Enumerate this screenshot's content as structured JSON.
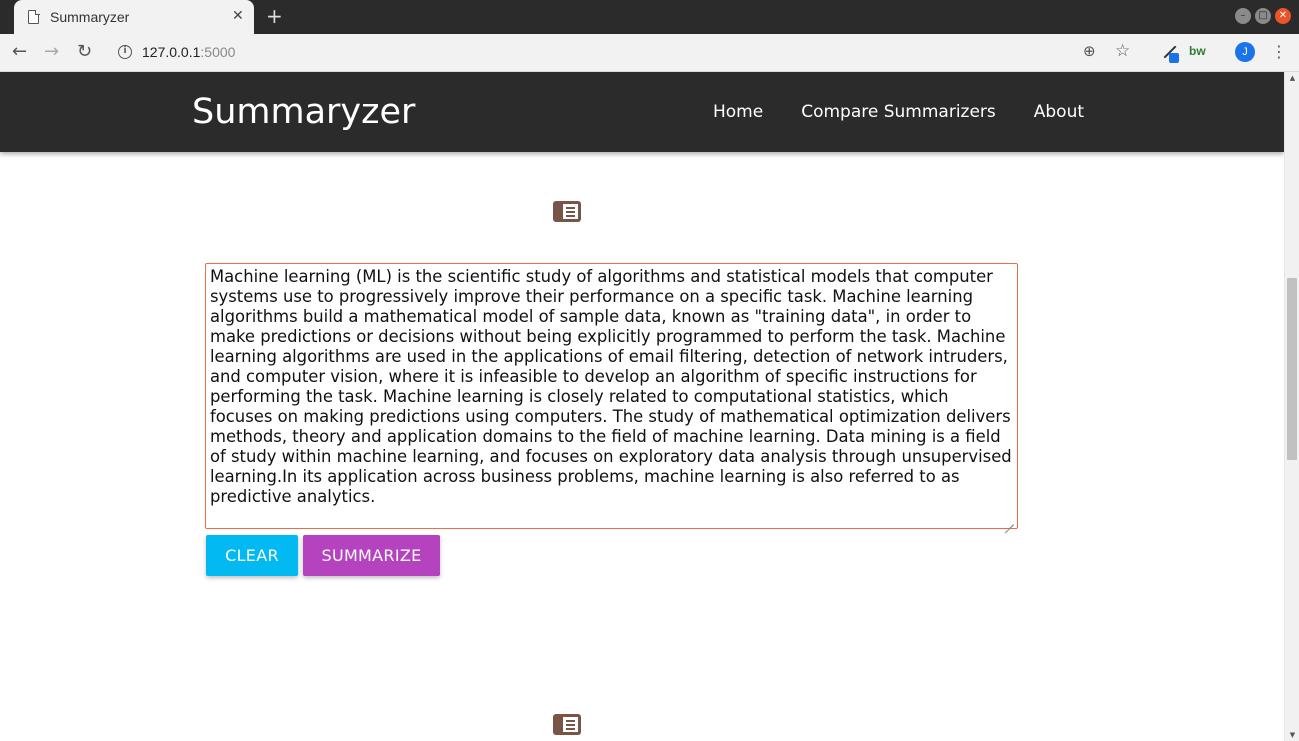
{
  "browser": {
    "tab_title": "Summaryzer",
    "tab_close": "✕",
    "new_tab": "+",
    "url_host": "127.0.0.1",
    "url_port": ":5000",
    "profile_initial": "J",
    "bw_extension_label": "bw"
  },
  "navbar": {
    "brand": "Summaryzer",
    "links": [
      "Home",
      "Compare Summarizers",
      "About"
    ]
  },
  "icons": {
    "top": "book-icon",
    "bottom": "book-icon",
    "color": "#795548"
  },
  "input": {
    "text": "Machine learning (ML) is the scientific study of algorithms and statistical models that computer systems use to progressively improve their performance on a specific task. Machine learning algorithms build a mathematical model of sample data, known as \"training data\", in order to make predictions or decisions without being explicitly programmed to perform the task. Machine learning algorithms are used in the applications of email filtering, detection of network intruders, and computer vision, where it is infeasible to develop an algorithm of specific instructions for performing the task. Machine learning is closely related to computational statistics, which focuses on making predictions using computers. The study of mathematical optimization delivers methods, theory and application domains to the field of machine learning. Data mining is a field of study within machine learning, and focuses on exploratory data analysis through unsupervised learning.In its application across business problems, machine learning is also referred to as predictive analytics."
  },
  "buttons": {
    "clear": "CLEAR",
    "summarize": "SUMMARIZE"
  },
  "colors": {
    "navbar_bg": "#2b2b2b",
    "clear_button": "#03b9f2",
    "summarize_button": "#b543c0",
    "textarea_border": "#ef6c46"
  }
}
